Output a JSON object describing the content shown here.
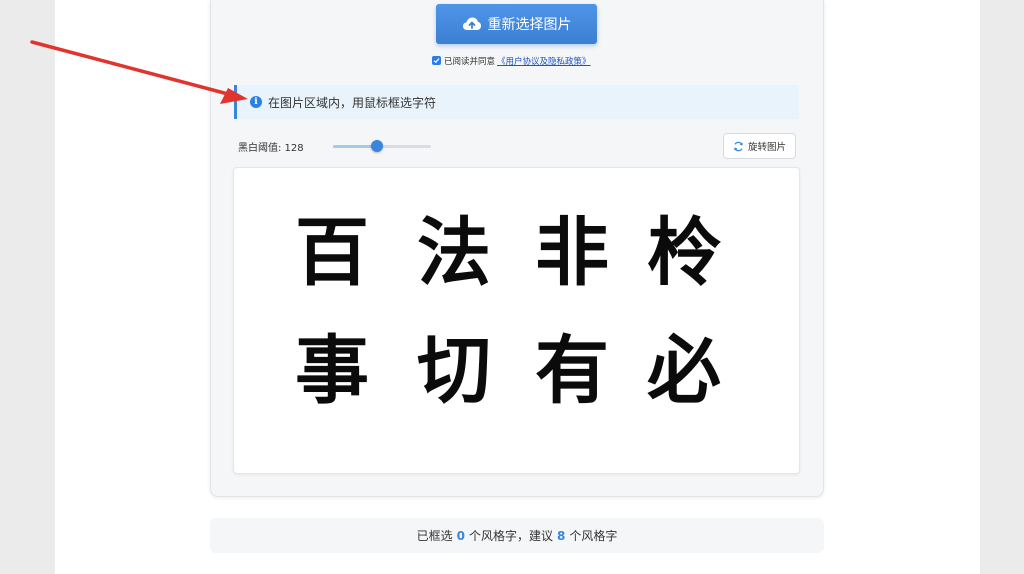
{
  "header": {
    "reselect_label": "重新选择图片",
    "upload_icon": "cloud-upload-icon"
  },
  "agreement": {
    "checked": true,
    "text": "已阅读并同意",
    "link_text": "《用户协议及隐私政策》"
  },
  "tip": {
    "icon": "info-icon",
    "text": "在图片区域内，用鼠标框选字符"
  },
  "threshold": {
    "label": "黑白阈值: 128",
    "value": 128,
    "max": 255
  },
  "rotate": {
    "label": "旋转图片",
    "icon": "rotate-icon"
  },
  "glyphs": [
    "百",
    "法",
    "非",
    "柃",
    "事",
    "切",
    "有",
    "必"
  ],
  "summary": {
    "prefix": "已框选",
    "selected": "0",
    "middle": "个风格字，建议",
    "suggested": "8",
    "suffix": "个风格字"
  },
  "colors": {
    "accent": "#3a86df",
    "arrow": "#e0342f"
  }
}
